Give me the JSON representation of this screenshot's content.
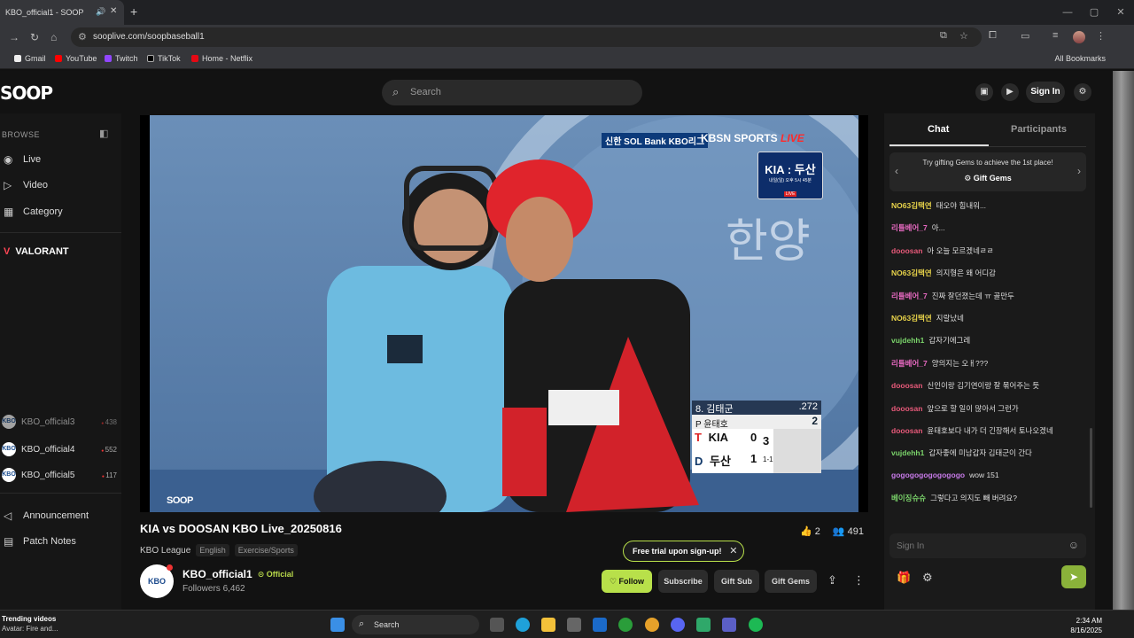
{
  "browser": {
    "tab_title": "KBO_official1 - SOOP",
    "url": "sooplive.com/soopbaseball1",
    "bookmarks": [
      "Gmail",
      "YouTube",
      "Twitch",
      "TikTok",
      "Home - Netflix"
    ],
    "all_bookmarks": "All Bookmarks"
  },
  "header": {
    "logo": "SOOP",
    "search_placeholder": "Search",
    "signin": "Sign In"
  },
  "sidebar": {
    "browse": "BROWSE",
    "nav": [
      "Live",
      "Video",
      "Category"
    ],
    "game": "VALORANT",
    "channels": [
      {
        "name": "KBO_official3",
        "count": "438"
      },
      {
        "name": "KBO_official4",
        "count": "552"
      },
      {
        "name": "KBO_official5",
        "count": "117"
      }
    ],
    "footer": [
      "Announcement",
      "Patch Notes"
    ]
  },
  "video": {
    "broadcaster_text": "신한 SOL Bank KBO리그",
    "network": "KBSN SPORTS",
    "live": "LIVE",
    "promo_matchup": "KIA : 두산",
    "promo_time": "내일(일) 오후 5시 45분",
    "promo_live": "LIVE",
    "batter_line": "8. 김태군",
    "batter_avg": ".272",
    "pitcher_line": "P 윤태호",
    "pitch_count": "2",
    "team1": "KIA",
    "score1": "0",
    "team2": "두산",
    "score2": "1",
    "inning": "3",
    "count": "1-1",
    "watermark": "SOOP"
  },
  "stream": {
    "title": "KIA vs DOOSAN KBO Live_20250816",
    "category": "KBO League",
    "tags": [
      "English",
      "Exercise/Sports"
    ],
    "likes": "2",
    "viewers": "491",
    "channel_name": "KBO_official1",
    "official": "Official",
    "followers": "Followers 6,462",
    "trial": "Free trial upon sign-up!",
    "follow": "Follow",
    "subscribe": "Subscribe",
    "gift_sub": "Gift Sub",
    "gift_gems": "Gift Gems"
  },
  "chat": {
    "tab_chat": "Chat",
    "tab_participants": "Participants",
    "banner_text": "Try gifting Gems to achieve the 1st place!",
    "banner_button": "Gift Gems",
    "input_placeholder": "Sign In",
    "messages": [
      {
        "user": "NO63김택연",
        "text": "태오야 힘내워...",
        "color": "#e8d34a"
      },
      {
        "user": "리틀베어_7",
        "text": "아...",
        "color": "#e86ac2"
      },
      {
        "user": "dooosan",
        "text": "아 오늘 모르겠네ㄹㄹ",
        "color": "#e85a7a"
      },
      {
        "user": "NO63김택연",
        "text": "의지형은 왜 어디감",
        "color": "#e8d34a"
      },
      {
        "user": "리틀베어_7",
        "text": "진짜 잘던졌는데 ㅠ 골만두",
        "color": "#e86ac2"
      },
      {
        "user": "NO63김택연",
        "text": "지랄났네",
        "color": "#e8d34a"
      },
      {
        "user": "vujdehh1",
        "text": "갑자기에그레",
        "color": "#7ad36a"
      },
      {
        "user": "리틀베어_7",
        "text": "양의지는 오ㅐ???",
        "color": "#e86ac2"
      },
      {
        "user": "dooosan",
        "text": "신인이랑 김기연이랑 잘 묶어주는 듯",
        "color": "#e85a7a"
      },
      {
        "user": "dooosan",
        "text": "앞으로 할 일이 많아서 그런가",
        "color": "#e85a7a"
      },
      {
        "user": "dooosan",
        "text": "윤태호보다 내가 더 긴장해서 토나오겠네",
        "color": "#e85a7a"
      },
      {
        "user": "vujdehh1",
        "text": "갑자좋에 미남갑자 김태군이 간다",
        "color": "#7ad36a"
      },
      {
        "user": "gogogogogogogogo",
        "text": "wow 151",
        "color": "#c77ae8"
      },
      {
        "user": "베이징슈슈",
        "text": "그렇다고 의지도 빼 버려요?",
        "color": "#7ad36a"
      }
    ]
  },
  "taskbar": {
    "trend_title": "Trending videos",
    "trend_sub": "Avatar: Fire and...",
    "search": "Search",
    "time": "2:34 AM",
    "date": "8/16/2025"
  }
}
